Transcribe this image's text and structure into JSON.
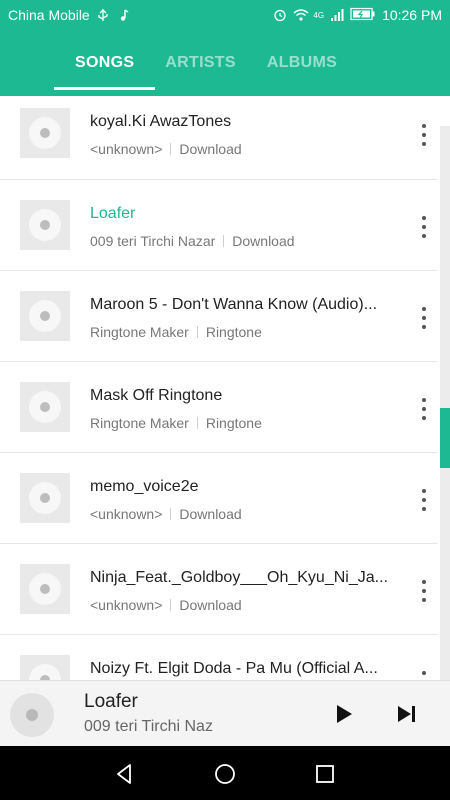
{
  "status_bar": {
    "carrier": "China Mobile",
    "time": "10:26 PM",
    "network": "4G"
  },
  "tabs": [
    {
      "label": "SONGS",
      "active": true
    },
    {
      "label": "ARTISTS",
      "active": false
    },
    {
      "label": "ALBUMS",
      "active": false
    }
  ],
  "songs": [
    {
      "title": "koyal.Ki AwazTones",
      "artist": "<unknown>",
      "album": "Download"
    },
    {
      "title": "Loafer",
      "artist": "009  teri Tirchi Nazar",
      "album": "Download",
      "playing": true
    },
    {
      "title": "Maroon 5 - Don't Wanna Know (Audio)...",
      "artist": "Ringtone Maker",
      "album": "Ringtone"
    },
    {
      "title": "Mask Off Ringtone",
      "artist": "Ringtone Maker",
      "album": "Ringtone"
    },
    {
      "title": "memo_voice2e",
      "artist": "<unknown>",
      "album": "Download"
    },
    {
      "title": "Ninja_Feat._Goldboy___Oh_Kyu_Ni_Ja...",
      "artist": "<unknown>",
      "album": "Download"
    },
    {
      "title": "Noizy Ft. Elgit Doda - Pa Mu (Official A...",
      "artist": "",
      "album": ""
    }
  ],
  "now_playing": {
    "title": "Loafer",
    "artist": "009  teri Tirchi Naz"
  },
  "colors": {
    "accent": "#1db993",
    "navbar": "#000000"
  }
}
